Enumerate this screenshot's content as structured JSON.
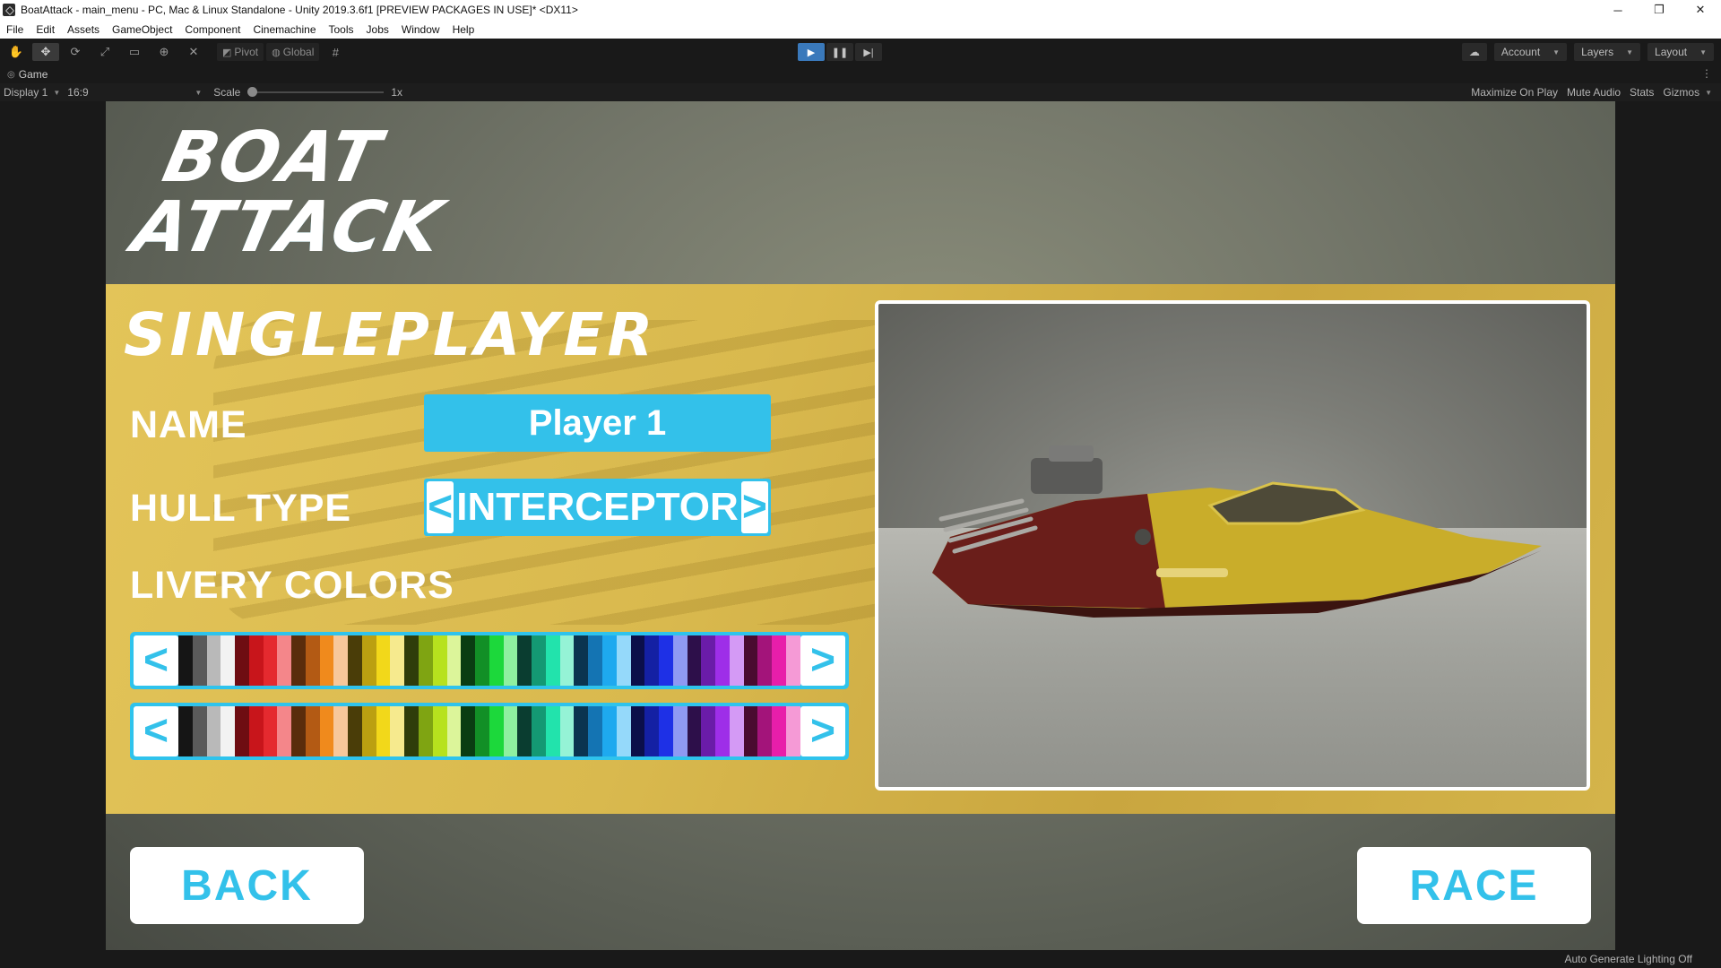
{
  "window": {
    "title": "BoatAttack - main_menu - PC, Mac & Linux Standalone - Unity 2019.3.6f1 [PREVIEW PACKAGES IN USE]* <DX11>",
    "minimize": "─",
    "restore": "❐",
    "close": "✕"
  },
  "menu": [
    "File",
    "Edit",
    "Assets",
    "GameObject",
    "Component",
    "Cinemachine",
    "Tools",
    "Jobs",
    "Window",
    "Help"
  ],
  "toolbar": {
    "pivot_label": "Pivot",
    "global_label": "Global",
    "account_label": "Account",
    "layers_label": "Layers",
    "layout_label": "Layout"
  },
  "game_tab": {
    "label": "Game",
    "display_label": "Display 1",
    "aspect_label": "16:9",
    "scale_label": "Scale",
    "scale_value": "1x",
    "maximize_label": "Maximize On Play",
    "mute_label": "Mute Audio",
    "stats_label": "Stats",
    "gizmos_label": "Gizmos"
  },
  "game": {
    "logo_line1": "BOAT",
    "logo_line2": "ATTACK",
    "heading": "SINGLEPLAYER",
    "name_label": "NAME",
    "name_value": "Player 1",
    "hull_label": "HULL TYPE",
    "hull_value": "INTERCEPTOR",
    "livery_label": "LIVERY COLORS",
    "arrow_left": "<",
    "arrow_right": ">",
    "back_label": "BACK",
    "race_label": "RACE",
    "swatch_colors": [
      "#151515",
      "#5a5a5a",
      "#b9b9b9",
      "#f2f2f2",
      "#6e0d12",
      "#c8151b",
      "#e52a2f",
      "#f4868a",
      "#5a2c0c",
      "#b35a14",
      "#f08a1c",
      "#f7c79a",
      "#4a3d08",
      "#bba011",
      "#f2d81a",
      "#f6ea8e",
      "#2f3d0a",
      "#7fa412",
      "#b7e21e",
      "#dcf59a",
      "#0a3d12",
      "#128f26",
      "#1cd83b",
      "#8ff0a0",
      "#0a3d30",
      "#149973",
      "#22e3ac",
      "#95f3d6",
      "#0b3450",
      "#1474b3",
      "#1ea9ef",
      "#95d9fa",
      "#0b0f4a",
      "#1420a3",
      "#1e30e6",
      "#8f99f3",
      "#2d0f4a",
      "#6a1ca8",
      "#9e2ee8",
      "#d49af5",
      "#4a0b30",
      "#a3147a",
      "#e81eaa",
      "#f59ad6"
    ]
  },
  "status": {
    "lighting": "Auto Generate Lighting Off"
  }
}
